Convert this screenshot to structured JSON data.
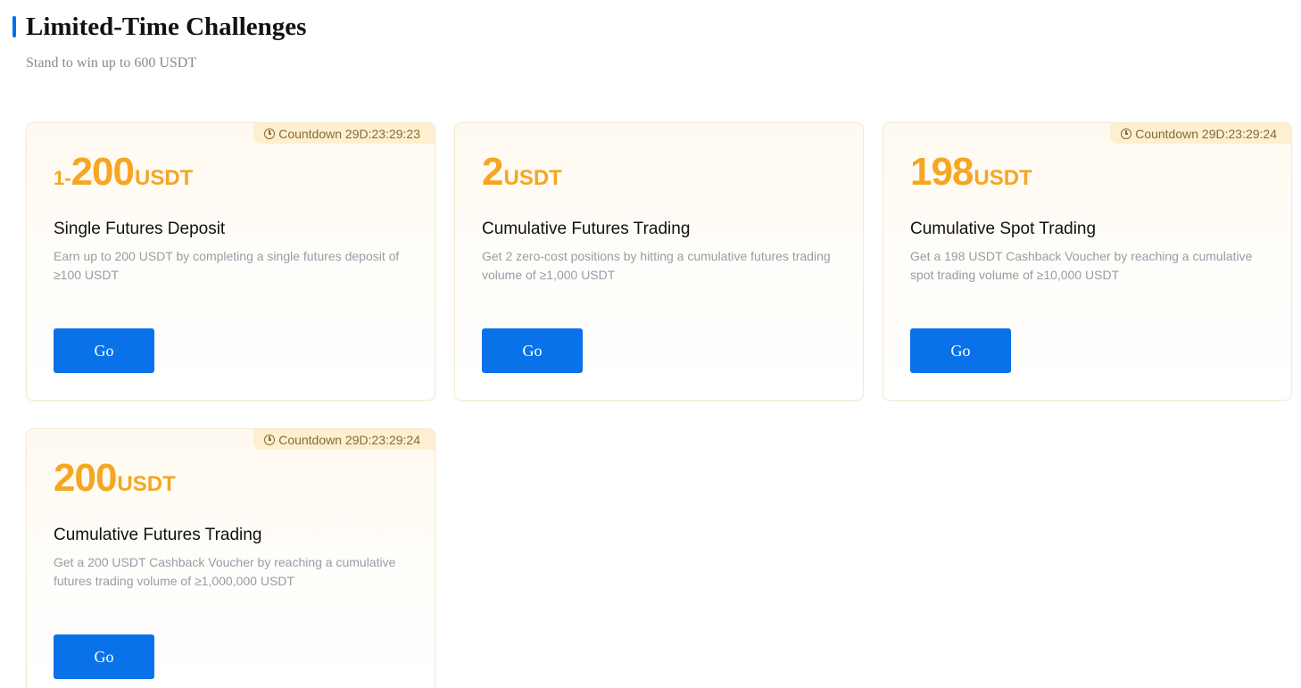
{
  "header": {
    "title": "Limited-Time Challenges",
    "subtitle": "Stand to win up to 600 USDT"
  },
  "cards": [
    {
      "countdown": "Countdown 29D:23:29:23",
      "reward_prefix": "1-",
      "reward_amount": "200",
      "reward_unit": "USDT",
      "title": "Single Futures Deposit",
      "description": "Earn up to 200 USDT by completing a single futures deposit of ≥100 USDT",
      "button": "Go"
    },
    {
      "countdown": "",
      "reward_prefix": "",
      "reward_amount": "2",
      "reward_unit": "USDT",
      "title": "Cumulative Futures Trading",
      "description": "Get 2 zero-cost positions by hitting a cumulative futures trading volume of ≥1,000 USDT",
      "button": "Go"
    },
    {
      "countdown": "Countdown 29D:23:29:24",
      "reward_prefix": "",
      "reward_amount": "198",
      "reward_unit": "USDT",
      "title": "Cumulative Spot Trading",
      "description": "Get a 198 USDT Cashback Voucher by reaching a cumulative spot trading volume of ≥10,000 USDT",
      "button": "Go"
    },
    {
      "countdown": "Countdown 29D:23:29:24",
      "reward_prefix": "",
      "reward_amount": "200",
      "reward_unit": "USDT",
      "title": "Cumulative Futures Trading",
      "description": "Get a 200 USDT Cashback Voucher by reaching a cumulative futures trading volume of ≥1,000,000 USDT",
      "button": "Go"
    }
  ],
  "colors": {
    "accent_blue": "#0a72e8",
    "reward_orange": "#f5a623",
    "countdown_bg": "#fdefcf"
  },
  "icons": {
    "countdown": "clock-icon"
  }
}
